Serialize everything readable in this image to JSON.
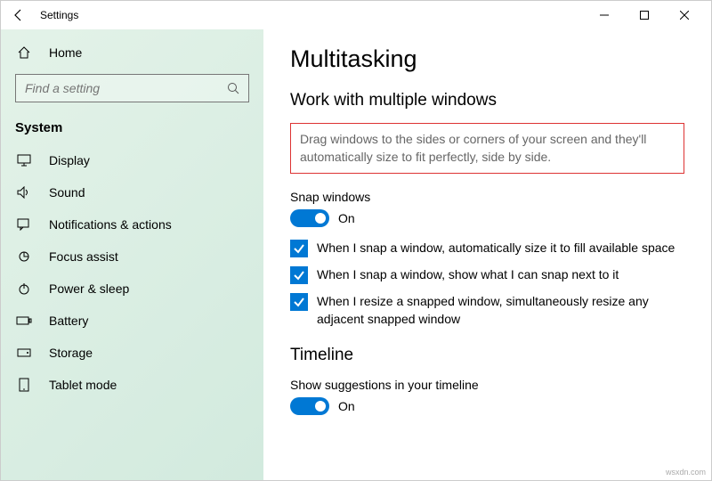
{
  "window": {
    "title": "Settings"
  },
  "sidebar": {
    "home": "Home",
    "search_placeholder": "Find a setting",
    "section": "System",
    "items": [
      {
        "label": "Display"
      },
      {
        "label": "Sound"
      },
      {
        "label": "Notifications & actions"
      },
      {
        "label": "Focus assist"
      },
      {
        "label": "Power & sleep"
      },
      {
        "label": "Battery"
      },
      {
        "label": "Storage"
      },
      {
        "label": "Tablet mode"
      }
    ]
  },
  "main": {
    "title": "Multitasking",
    "section1": {
      "heading": "Work with multiple windows",
      "description": "Drag windows to the sides or corners of your screen and they'll automatically size to fit perfectly, side by side.",
      "snap_label": "Snap windows",
      "snap_state": "On",
      "checks": [
        "When I snap a window, automatically size it to fill available space",
        "When I snap a window, show what I can snap next to it",
        "When I resize a snapped window, simultaneously resize any adjacent snapped window"
      ]
    },
    "section2": {
      "heading": "Timeline",
      "suggest_label": "Show suggestions in your timeline",
      "suggest_state": "On"
    }
  },
  "watermark": "wsxdn.com"
}
